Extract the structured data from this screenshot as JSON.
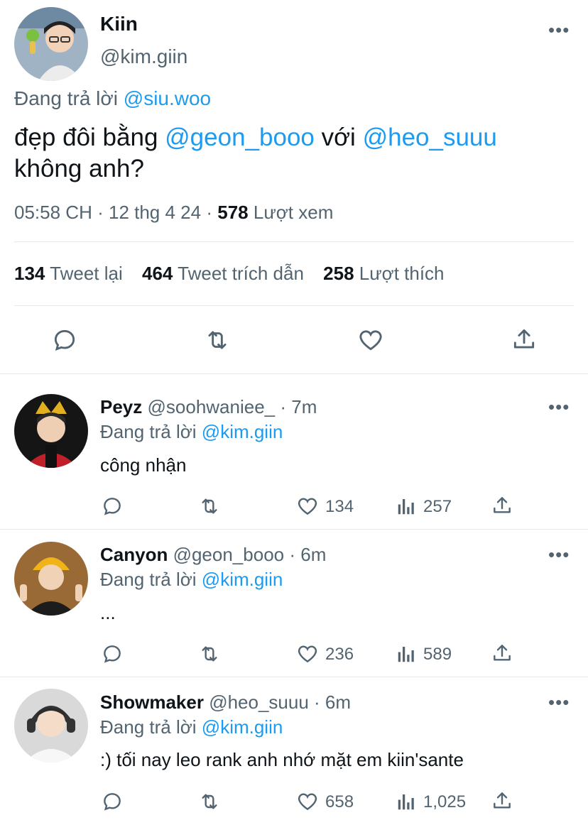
{
  "main_tweet": {
    "author_name": "Kiin",
    "author_handle": "@kim.giin",
    "replying_prefix": "Đang trả lời",
    "replying_to": "@siu.woo",
    "text_1": "đẹp đôi bằng",
    "mention_1": "@geon_booo",
    "text_2": "với",
    "mention_2": "@heo_suuu",
    "text_3": "không anh?",
    "time": "05:58 CH",
    "sep": "·",
    "date": "12 thg 4 24",
    "sep2": "·",
    "views_count": "578",
    "views_label": "Lượt xem",
    "retweets_count": "134",
    "retweets_label": "Tweet lại",
    "quotes_count": "464",
    "quotes_label": "Tweet trích dẫn",
    "likes_count": "258",
    "likes_label": "Lượt thích"
  },
  "replies": [
    {
      "name": "Peyz",
      "handle": "@soohwaniee_",
      "time": "· 7m",
      "replying_prefix": "Đang trả lời",
      "replying_to": "@kim.giin",
      "text": "công nhận",
      "likes": "134",
      "views": "257"
    },
    {
      "name": "Canyon",
      "handle": "@geon_booo",
      "time": "· 6m",
      "replying_prefix": "Đang trả lời",
      "replying_to": "@kim.giin",
      "text": "...",
      "likes": "236",
      "views": "589"
    },
    {
      "name": "Showmaker",
      "handle": "@heo_suuu",
      "time": "· 6m",
      "replying_prefix": "Đang trả lời",
      "replying_to": "@kim.giin",
      "text": ":) tối nay leo rank anh nhớ mặt em kiin'sante",
      "likes": "658",
      "views": "1,025"
    }
  ],
  "colors": {
    "accent": "#1d9bf0",
    "muted": "#536471",
    "text": "#0f1419",
    "divider": "#e6e9eb"
  }
}
